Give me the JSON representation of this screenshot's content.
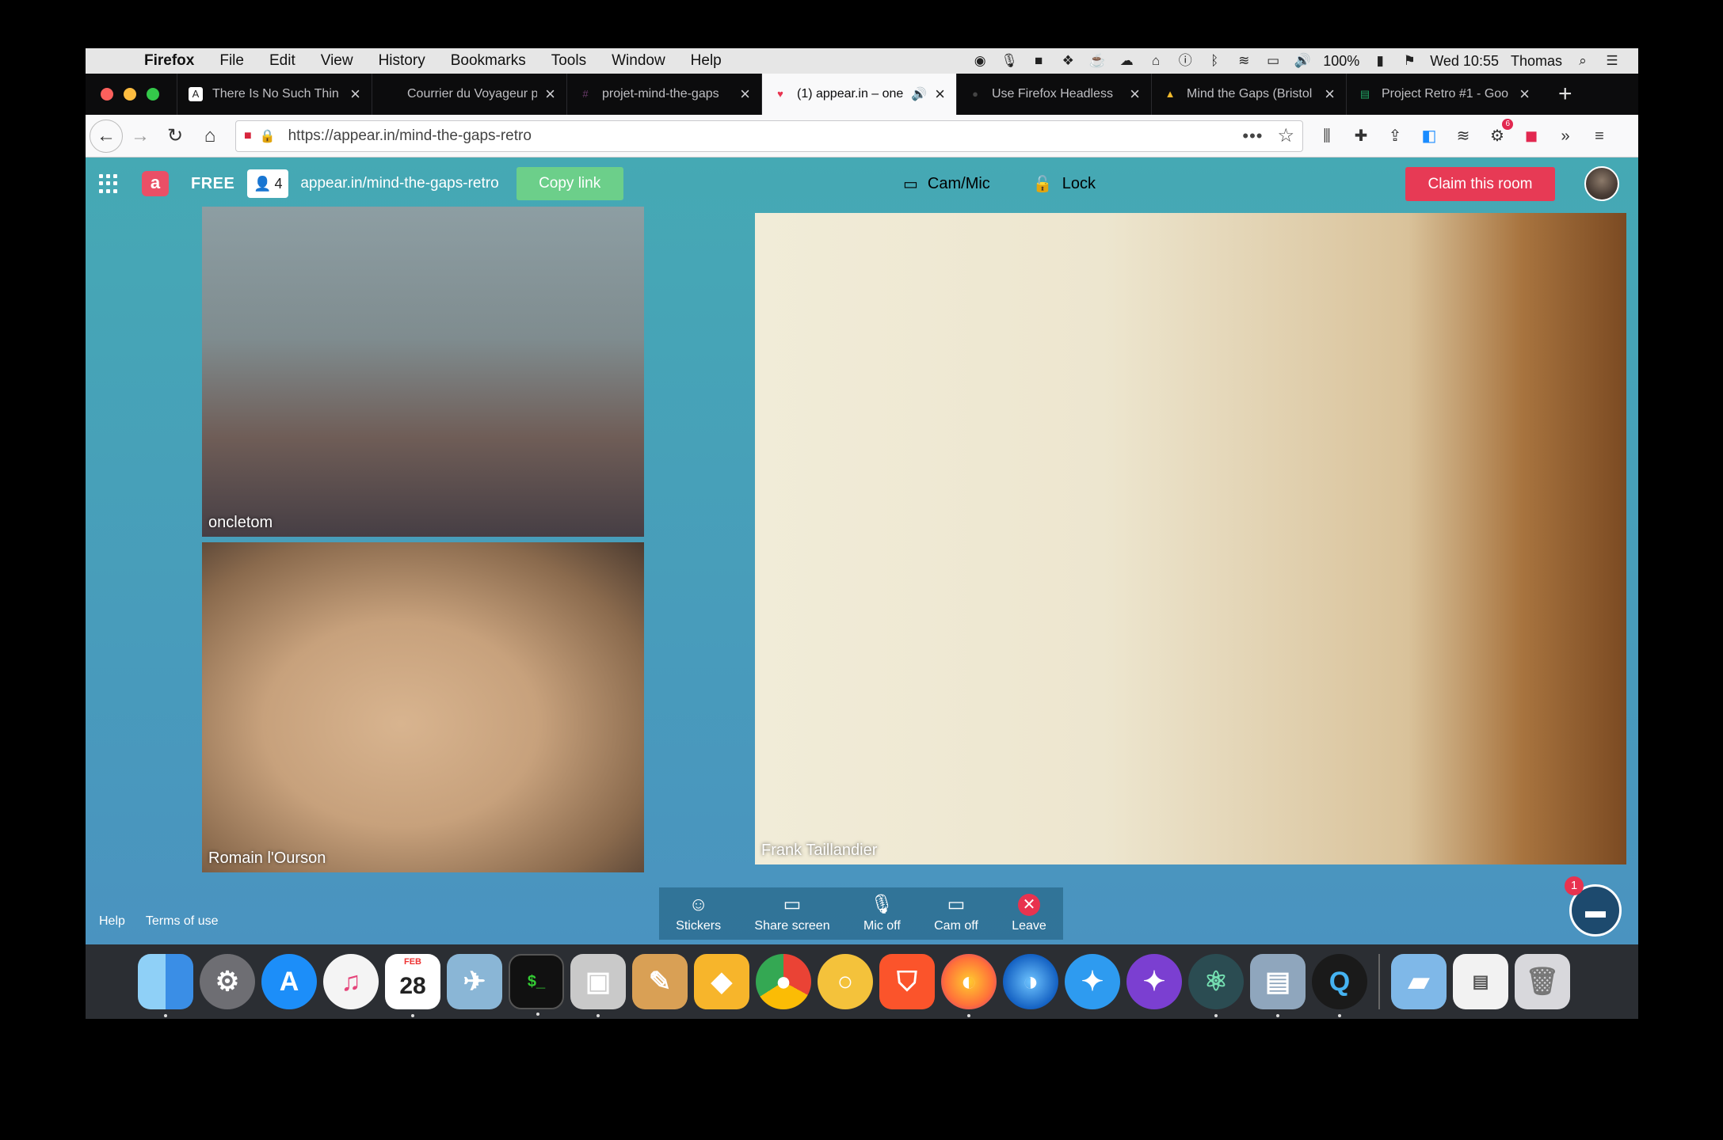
{
  "menubar": {
    "app_name": "Firefox",
    "items": [
      "File",
      "Edit",
      "View",
      "History",
      "Bookmarks",
      "Tools",
      "Window",
      "Help"
    ],
    "battery": "100%",
    "clock": "Wed 10:55",
    "user": "Thomas"
  },
  "tabs": [
    {
      "title": "There Is No Such Thin",
      "favicon": "A",
      "favicon_color": "#222222"
    },
    {
      "title": "Courrier du Voyageur peut",
      "favicon": "",
      "favicon_color": ""
    },
    {
      "title": "projet-mind-the-gaps",
      "favicon": "#",
      "favicon_color": "#6b3b6b"
    },
    {
      "title": "(1) appear.in – one",
      "favicon": "♥",
      "favicon_color": "#e8334f",
      "active": true
    },
    {
      "title": "Use Firefox Headless",
      "favicon": "●",
      "favicon_color": "#444444"
    },
    {
      "title": "Mind the Gaps (Bristol",
      "favicon": "▲",
      "favicon_color": "#f2b92c"
    },
    {
      "title": "Project Retro #1 - Goo",
      "favicon": "▤",
      "favicon_color": "#22a565"
    }
  ],
  "navbar": {
    "url": "https://appear.in/mind-the-gaps-retro",
    "extension_badge": "6"
  },
  "appear": {
    "plan": "FREE",
    "participants": "4",
    "room": "appear.in/mind-the-gaps-retro",
    "copy_link": "Copy link",
    "cam_mic": "Cam/Mic",
    "lock": "Lock",
    "claim": "Claim this room"
  },
  "videos": {
    "oncletom": "oncletom",
    "romain": "Romain l'Ourson",
    "frank": "Frank Taillandier"
  },
  "controls": {
    "stickers": "Stickers",
    "share_screen": "Share screen",
    "mic_off": "Mic off",
    "cam_off": "Cam off",
    "leave": "Leave"
  },
  "footer": {
    "help": "Help",
    "terms": "Terms of use"
  },
  "chat_badge": "1",
  "dock": {
    "calendar_month": "FEB",
    "calendar_day": "28"
  }
}
